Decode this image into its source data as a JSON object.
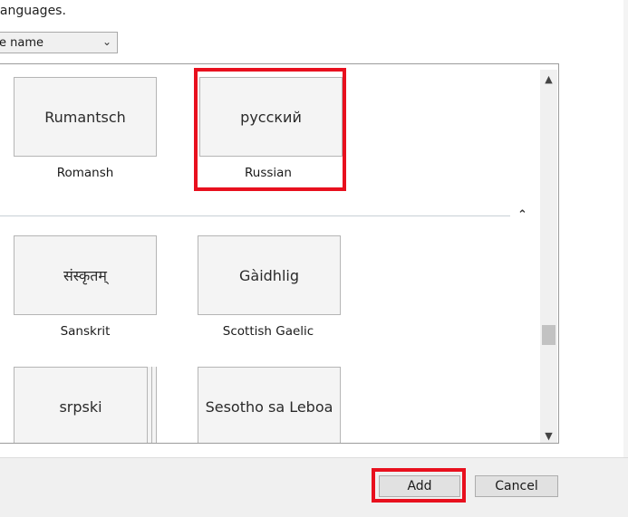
{
  "hint_text": "languages.",
  "sort": {
    "selected": "e name"
  },
  "languages": [
    {
      "native": "Rumantsch",
      "english": "Romansh"
    },
    {
      "native": "русский",
      "english": "Russian"
    },
    {
      "native": "संस्कृतम्",
      "english": "Sanskrit"
    },
    {
      "native": "Gàidhlig",
      "english": "Scottish Gaelic"
    },
    {
      "native": "srpski",
      "english": ""
    },
    {
      "native": "Sesotho sa Leboa",
      "english": ""
    }
  ],
  "buttons": {
    "add": "Add",
    "cancel": "Cancel"
  },
  "colors": {
    "highlight": "#e8101e",
    "footer": "#f0f0f0",
    "tile": "#f4f4f4"
  }
}
